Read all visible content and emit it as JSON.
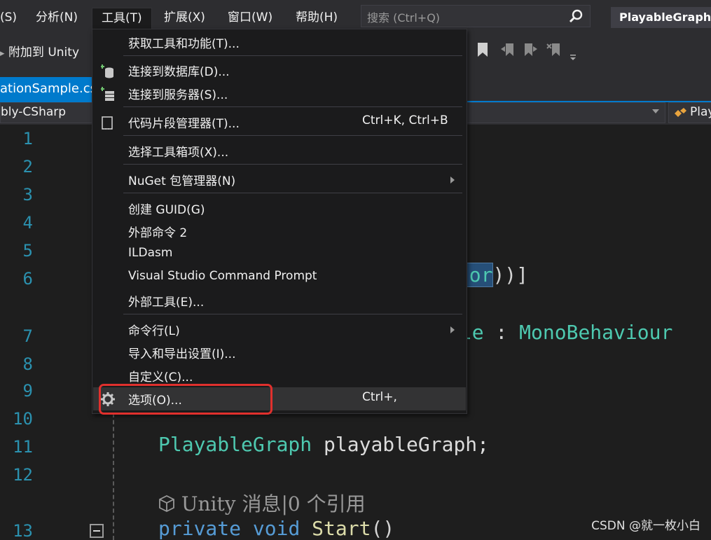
{
  "menubar": {
    "items": [
      "(S)",
      "分析(N)",
      "工具(T)",
      "扩展(X)",
      "窗口(W)",
      "帮助(H)"
    ],
    "open_item": "工具(T)",
    "search_placeholder": "搜索 (Ctrl+Q)",
    "app_title": "PlayableGraph"
  },
  "toolbar": {
    "attach_label": "附加到 Unity"
  },
  "tab": {
    "label": "ationSample.cs"
  },
  "navbar": {
    "project": "bly-CSharp",
    "member": "Play"
  },
  "editor": {
    "line_numbers": [
      "1",
      "2",
      "3",
      "4",
      "5",
      "6",
      "7",
      "8",
      "9",
      "10",
      "11",
      "12",
      "13"
    ],
    "line6_visible": "ator",
    "line6_suffix": "))]",
    "line7_visible": "ple",
    "line7_colon": " : ",
    "line7_base": "MonoBehaviour",
    "line11_type": "PlayableGraph",
    "line11_rest": " playableGraph;",
    "codelens": "Unity 消息|0 个引用",
    "codelens_icon": "unity-cube-icon",
    "line13_private": "private",
    "line13_void": "void",
    "line13_name": "Start",
    "line13_parens": "()"
  },
  "menu": {
    "items": [
      {
        "label": "获取工具和功能(T)...",
        "shortcut": "",
        "icon": ""
      },
      {
        "label": "连接到数据库(D)...",
        "shortcut": "",
        "icon": "database-connect-icon"
      },
      {
        "label": "连接到服务器(S)...",
        "shortcut": "",
        "icon": "server-connect-icon"
      },
      {
        "label": "代码片段管理器(T)...",
        "shortcut": "Ctrl+K, Ctrl+B",
        "icon": "snippet-icon"
      },
      {
        "label": "选择工具箱项(X)...",
        "shortcut": "",
        "icon": ""
      },
      {
        "label": "NuGet 包管理器(N)",
        "shortcut": "",
        "icon": "",
        "submenu": true
      },
      {
        "label": "创建 GUID(G)",
        "shortcut": "",
        "icon": ""
      },
      {
        "label": "外部命令 2",
        "shortcut": "",
        "icon": ""
      },
      {
        "label": "ILDasm",
        "shortcut": "",
        "icon": ""
      },
      {
        "label": "Visual Studio Command Prompt",
        "shortcut": "",
        "icon": ""
      },
      {
        "label": "外部工具(E)...",
        "shortcut": "",
        "icon": ""
      },
      {
        "label": "命令行(L)",
        "shortcut": "",
        "icon": "",
        "submenu": true
      },
      {
        "label": "导入和导出设置(I)...",
        "shortcut": "",
        "icon": ""
      },
      {
        "label": "自定义(C)...",
        "shortcut": "",
        "icon": ""
      },
      {
        "label": "选项(O)...",
        "shortcut": "Ctrl+,",
        "icon": "gear-icon",
        "highlighted": true
      }
    ]
  },
  "colors": {
    "accent": "#007acc",
    "highlight_box": "#e0302d",
    "type_color": "#4ec9b0",
    "keyword_color": "#569cd6",
    "method_color": "#dcdcaa"
  },
  "watermark": "CSDN @就一枚小白"
}
